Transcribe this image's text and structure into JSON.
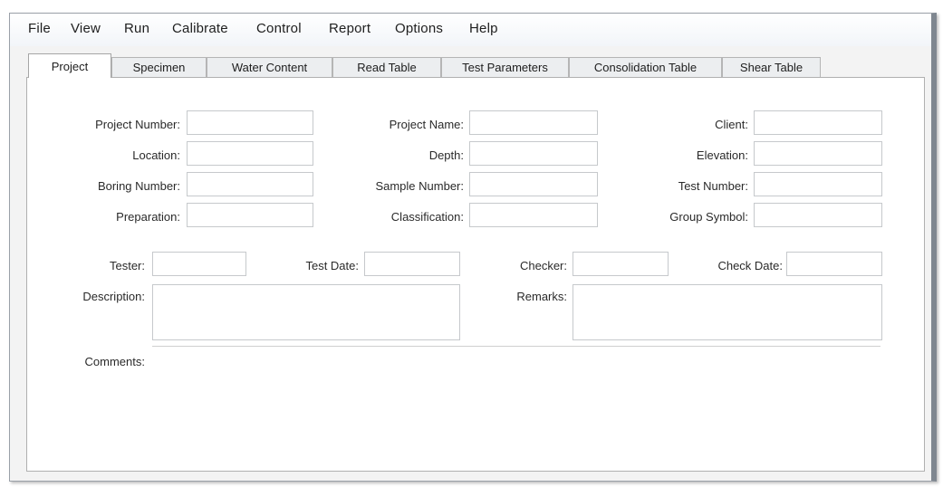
{
  "menu": [
    "File",
    "View",
    "Run",
    "Calibrate",
    "Control",
    "Report",
    "Options",
    "Help"
  ],
  "tabs": [
    "Project",
    "Specimen",
    "Water Content",
    "Read Table",
    "Test Parameters",
    "Consolidation Table",
    "Shear Table"
  ],
  "active_tab": "Project",
  "form": {
    "project_number": "Project Number:",
    "project_name": "Project Name:",
    "client": "Client:",
    "location": "Location:",
    "depth": "Depth:",
    "elevation": "Elevation:",
    "boring_number": "Boring Number:",
    "sample_number": "Sample Number:",
    "test_number": "Test Number:",
    "preparation": "Preparation:",
    "classification": "Classification:",
    "group_symbol": "Group Symbol:",
    "tester": "Tester:",
    "test_date": "Test Date:",
    "checker": "Checker:",
    "check_date": "Check Date:",
    "description": "Description:",
    "remarks": "Remarks:",
    "comments": "Comments:"
  }
}
